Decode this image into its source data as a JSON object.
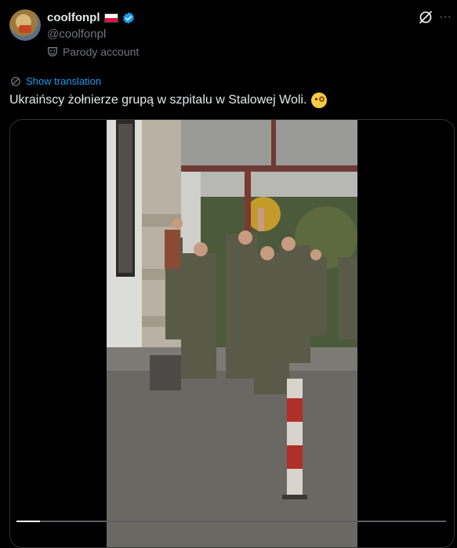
{
  "author": {
    "display_name": "coolfonpl",
    "handle": "@coolfonpl",
    "label": "Parody account",
    "flag_icon": "poland-flag-icon",
    "verified_icon": "verified-badge-icon"
  },
  "actions": {
    "grok_icon": "grok-icon",
    "more_icon": "more-icon",
    "more_glyph": "···"
  },
  "translation": {
    "link_text": "Show translation",
    "icon": "globe-icon"
  },
  "tweet": {
    "text": "Ukraińscy żołnierze grupą w szpitalu w Stalowej Woli.",
    "emoji": "monocle-face-emoji"
  },
  "video": {
    "progress": 0.054
  },
  "colors": {
    "background": "#000000",
    "text": "#e7e9ea",
    "secondary": "#71767b",
    "accent": "#1d9bf0",
    "border": "#2f3336"
  }
}
